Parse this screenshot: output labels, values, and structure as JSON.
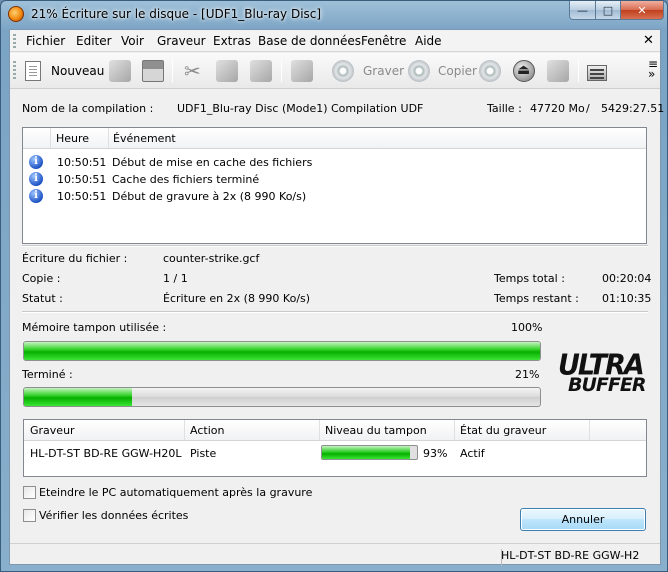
{
  "window": {
    "title": "21% Écriture sur le disque - [UDF1_Blu-ray Disc]"
  },
  "menu": [
    "Fichier",
    "Editer",
    "Voir",
    "Graveur",
    "Extras",
    "Base de données",
    "Fenêtre",
    "Aide"
  ],
  "toolbar": {
    "new_label": "Nouveau",
    "burn_label": "Graver",
    "copy_label": "Copier"
  },
  "compilation": {
    "name_label": "Nom de la compilation :",
    "name_value": "UDF1_Blu-ray Disc (Mode1)",
    "type_value": "Compilation UDF",
    "size_label": "Taille :",
    "size_value": "47720 Mo",
    "size_sep": "/",
    "time_value": "5429:27.51"
  },
  "log": {
    "columns": [
      "Heure",
      "Événement"
    ],
    "rows": [
      {
        "time": "10:50:51",
        "event": "Début de mise en cache des fichiers"
      },
      {
        "time": "10:50:51",
        "event": "Cache des fichiers terminé"
      },
      {
        "time": "10:50:51",
        "event": "Début de gravure à 2x (8 990 Ko/s)"
      }
    ]
  },
  "status": {
    "file_label": "Écriture du fichier :",
    "file_value": "counter-strike.gcf",
    "copy_label": "Copie :",
    "copy_value": "1 / 1",
    "state_label": "Statut :",
    "state_value": "Écriture en 2x (8 990 Ko/s)",
    "total_time_label": "Temps total :",
    "total_time_value": "00:20:04",
    "remaining_label": "Temps restant :",
    "remaining_value": "01:10:35"
  },
  "buffer": {
    "label": "Mémoire tampon utilisée :",
    "percent_text": "100%",
    "fraction": 1.0
  },
  "progress": {
    "label": "Terminé :",
    "percent_text": "21%",
    "fraction": 0.21
  },
  "logo": {
    "line1": "ULTRA",
    "line2": "BUFFER"
  },
  "drives": {
    "columns": [
      "Graveur",
      "Action",
      "Niveau du tampon",
      "État du graveur"
    ],
    "rows": [
      {
        "recorder": "HL-DT-ST BD-RE  GGW-H20L",
        "action": "Piste",
        "buffer_text": "93%",
        "buffer_fraction": 0.93,
        "state": "Actif"
      }
    ]
  },
  "options": {
    "shutdown_label": "Eteindre le PC automatiquement après la gravure",
    "shutdown_checked": false,
    "verify_label": "Vérifier les données écrites",
    "verify_checked": false
  },
  "cancel_label": "Annuler",
  "statusbar_text": "HL-DT-ST BD-RE  GGW-H2"
}
